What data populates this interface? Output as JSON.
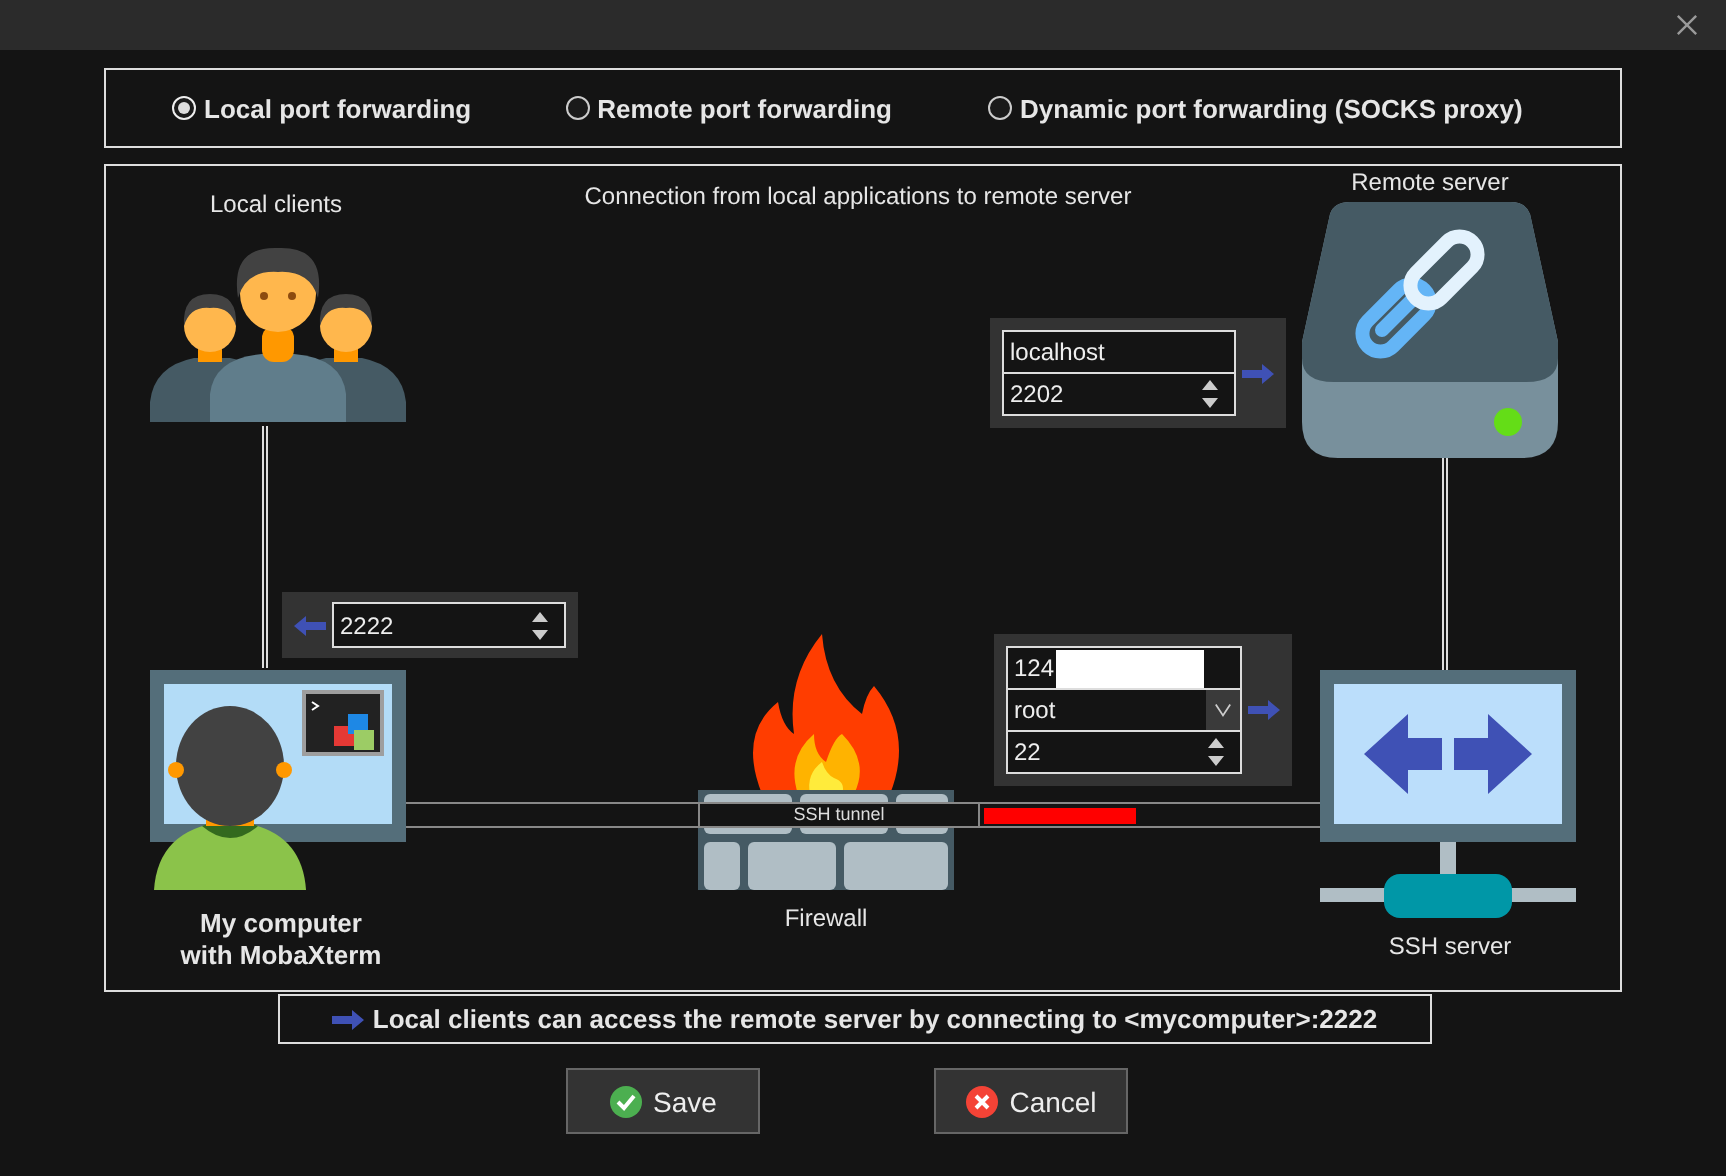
{
  "forwarding_modes": [
    {
      "label": "Local port forwarding",
      "selected": true
    },
    {
      "label": "Remote port forwarding",
      "selected": false
    },
    {
      "label": "Dynamic port forwarding (SOCKS proxy)",
      "selected": false
    }
  ],
  "diagram": {
    "caption": "Connection from local applications to remote server",
    "local_clients": {
      "label": "Local clients"
    },
    "local_port": {
      "value": "2222"
    },
    "my_computer": {
      "label_lines": [
        "My computer",
        "with MobaXterm"
      ]
    },
    "remote_server": {
      "label": "Remote server",
      "host": "localhost",
      "port": "2202"
    },
    "firewall": {
      "label": "Firewall"
    },
    "tunnel": {
      "label": "SSH tunnel"
    },
    "ssh_server": {
      "label": "SSH server",
      "host": "124",
      "host_redacted": true,
      "user": "root",
      "port": "22"
    }
  },
  "info": "Local clients can access the remote server by connecting to <mycomputer>:2222",
  "buttons": [
    {
      "label": "Save",
      "kind": "save"
    },
    {
      "label": "Cancel",
      "kind": "cancel"
    }
  ]
}
